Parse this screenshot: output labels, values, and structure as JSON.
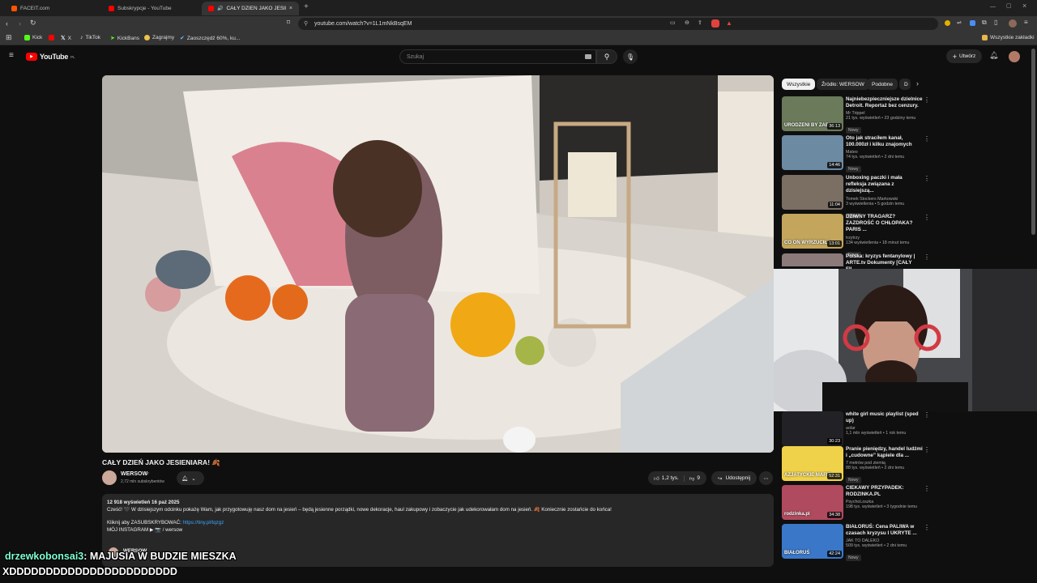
{
  "browser": {
    "tabs": [
      {
        "label": "FACEIT.com",
        "active": false
      },
      {
        "label": "Subskrypcje - YouTube",
        "active": false
      },
      {
        "label": "CAŁY DZIEŃ JAKO JESIENIAR...",
        "active": true
      }
    ],
    "url": "youtube.com/watch?v=1L1mNkBsqEM",
    "bookmarks": [
      "Kick",
      "X",
      "TikTok",
      "KickBans",
      "Zagrajmy",
      "Zaoszczędź 60%, ku..."
    ],
    "all_bookmarks": "Wszystkie zakładki"
  },
  "youtube": {
    "logo": "YouTube",
    "logo_region": "PL",
    "search_placeholder": "Szukaj",
    "create_label": "Utwórz"
  },
  "video": {
    "title": "CAŁY DZIEŃ JAKO JESIENIARA! 🍂",
    "channel": "WERSOW",
    "subscribers": "2,72 mln subskrybentów",
    "likes": "1,2 tys.",
    "dislikes": "9",
    "share": "Udostępnij",
    "views_date": "12 918 wyświetleń  16 paź 2025",
    "description": "Cześć! 🖤 W dzisiejszym odcinku pokażę Wam, jak przygotowuję nasz dom na jesień – będą jesienne porządki, nowe dekoracje, haul zakupowy i zobaczycie jak udekorowałam dom na jesień. 🍂 Koniecznie zostańcie do końca!",
    "subscribe_line": "Kliknij aby ZASUBSKRYBOWAĆ: ",
    "subscribe_link": "https://tiny.pl/tqzgz",
    "instagram_line": "MÓJ INSTAGRAM ▶ 📷 / wersow",
    "channel_again": "WERSOW"
  },
  "sidebar": {
    "chips": [
      "Wszystkie",
      "Źródło: WERSOW",
      "Podobne",
      "D"
    ],
    "videos": [
      {
        "title": "Najniebezpieczniejsze dzielnice Detroit. Reportaż bez cenzury.",
        "channel": "Mr Trippel",
        "meta": "21 tys. wyświetleń • 23 godziny temu",
        "badge": "Nowy",
        "duration": "36:13",
        "thumb_text": "URODZENI BY ZABI"
      },
      {
        "title": "Oto jak straciłem kanał, 100.000zł i kilku znajomych",
        "channel": "Mateo",
        "meta": "74 tys. wyświetleń • 2 dni temu",
        "badge": "Nowy",
        "duration": "14:46",
        "thumb_text": ""
      },
      {
        "title": "Unboxing paczki i mała refleksja związana z dzisiejszą...",
        "channel": "Tomek Stockers Markowski",
        "meta": "3 wyświetlenia • 5 godzin temu",
        "badge": "Nowy",
        "duration": "11:04",
        "thumb_text": ""
      },
      {
        "title": "DZIWNY TRAGARZ? ZAZDROŚĆ O CHŁOPAKA? PARIS ...",
        "channel": "trzytrzy",
        "meta": "134 wyświetlenia • 18 minut temu",
        "badge": "Nowy",
        "duration": "13:01",
        "thumb_text": "CO ON WYRZUCIŁ?"
      },
      {
        "title": "Polska: kryzys fentanylowy | ARTE.tv Dokumenty [CAŁY FIL...",
        "channel": "",
        "meta": "",
        "badge": "",
        "duration": "",
        "thumb_text": ""
      },
      {
        "title": "white girl music playlist (sped up)",
        "channel": "aolar",
        "meta": "1,1 mln wyświetleń • 1 rok temu",
        "badge": "",
        "duration": "30:23",
        "thumb_text": ""
      },
      {
        "title": "Pranie pieniędzy, handel ludźmi i „cudowne” kąpiele dla ...",
        "channel": "7 metrów pod ziemią",
        "meta": "88 tys. wyświetleń • 2 dni temu",
        "badge": "Nowy",
        "duration": "52:31",
        "thumb_text": "AZJATYCKIE MAFIE"
      },
      {
        "title": "CIEKAWY PRZYPADEK: RODZINKA.PL",
        "channel": "PsychoLoszka",
        "meta": "198 tys. wyświetleń • 3 tygodnie temu",
        "badge": "",
        "duration": "34:38",
        "thumb_text": "rodzinka.pl"
      },
      {
        "title": "BIAŁORUŚ: Cena PALIWA w czasach kryzysu I UKRYTE ...",
        "channel": "JAK TO DALEKO",
        "meta": "509 tys. wyświetleń • 2 dni temu",
        "badge": "Nowy",
        "duration": "42:24",
        "thumb_text": "BIAŁORUŚ"
      }
    ]
  },
  "chat": {
    "username": "drzewkobonsai3",
    "message": ": MAJUSIA W BUDZIE MIESZKA",
    "message2": "XDDDDDDDDDDDDDDDDDDDDDDD"
  },
  "colors": {
    "accent": "#ff0000",
    "link": "#3ea6ff",
    "chat_user": "#7fffd4"
  }
}
